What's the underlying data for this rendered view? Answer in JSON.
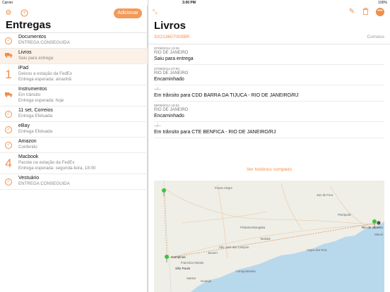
{
  "status": {
    "carrier": "Carrier",
    "time": "3:00 PM",
    "battery": "100%"
  },
  "left": {
    "add_label": "Adicionar",
    "title": "Entregas",
    "items": [
      {
        "title": "Documentos",
        "subtitle": "ENTREGA CONSEGUIDA",
        "sub2": "",
        "icon": "check-circle-icon"
      },
      {
        "title": "Livros",
        "subtitle": "Saiu para entrega",
        "sub2": "",
        "icon": "truck-icon",
        "selected": true
      },
      {
        "title": "iPad",
        "subtitle": "Deixou a estação da FedEx",
        "sub2": "Entrega esperada: amanhã",
        "icon": "1"
      },
      {
        "title": "Instrumentos",
        "subtitle": "Em trânsito",
        "sub2": "Entrega esperada: hoje",
        "icon": "truck-icon"
      },
      {
        "title": "11 set, Correios",
        "subtitle": "Entrega Efetuada",
        "sub2": "",
        "icon": "check-circle-icon"
      },
      {
        "title": "eBay",
        "subtitle": "Entrega Efetuada",
        "sub2": "",
        "icon": "check-circle-icon"
      },
      {
        "title": "Amazon",
        "subtitle": "Conferido",
        "sub2": "",
        "icon": "check-circle-icon"
      },
      {
        "title": "Macbook",
        "subtitle": "Pacote na estação da FedEx",
        "sub2": "Entrega esperada: segunda-feira, 18:00",
        "icon": "4"
      },
      {
        "title": "Vestuário",
        "subtitle": "ENTREGA CONSEGUIDA",
        "sub2": "",
        "icon": "check-circle-icon"
      }
    ]
  },
  "right": {
    "title": "Livros",
    "tracking": "SX213607000BR",
    "carrier": "Correios",
    "history_link": "Ver histórico completo",
    "events": [
      {
        "date": "07/08/2014 13:25",
        "location": "RIO DE JANEIRO",
        "message": "Saiu para entrega"
      },
      {
        "date": "07/08/2014 07:00",
        "location": "RIO DE JANEIRO",
        "message": "Encaminhado"
      },
      {
        "date": "",
        "location": "--/--",
        "message": "Em trânsito para CDD BARRA DA TIJUCA - RIO DE JANEIRO/RJ"
      },
      {
        "date": "06/08/2014 15:52",
        "location": "RIO DE JANEIRO",
        "message": "Encaminhado"
      },
      {
        "date": "",
        "location": "--/--",
        "message": "Em trânsito para CTE BENFICA - RIO DE JANEIRO/RJ"
      }
    ]
  },
  "map": {
    "labels": [
      "Pouso Alegre",
      "Juiz de Fora",
      "Petrópolis",
      "Pindamonhangaba",
      "Taubaté",
      "Jacareí",
      "São José dos Campos",
      "Campinas",
      "São Paulo",
      "Santos",
      "Guarujá",
      "Francisco Morato",
      "Caraguatatuba",
      "Angra dos Reis",
      "Rio de Janeiro",
      "Niterói"
    ],
    "colors": {
      "land": "#efeee7",
      "water": "#b8d8ec",
      "route": "#d98c5a",
      "pin": "#3bc43b"
    }
  },
  "colors": {
    "accent": "#ef8f4a",
    "selected_row": "#fbf1e6"
  }
}
